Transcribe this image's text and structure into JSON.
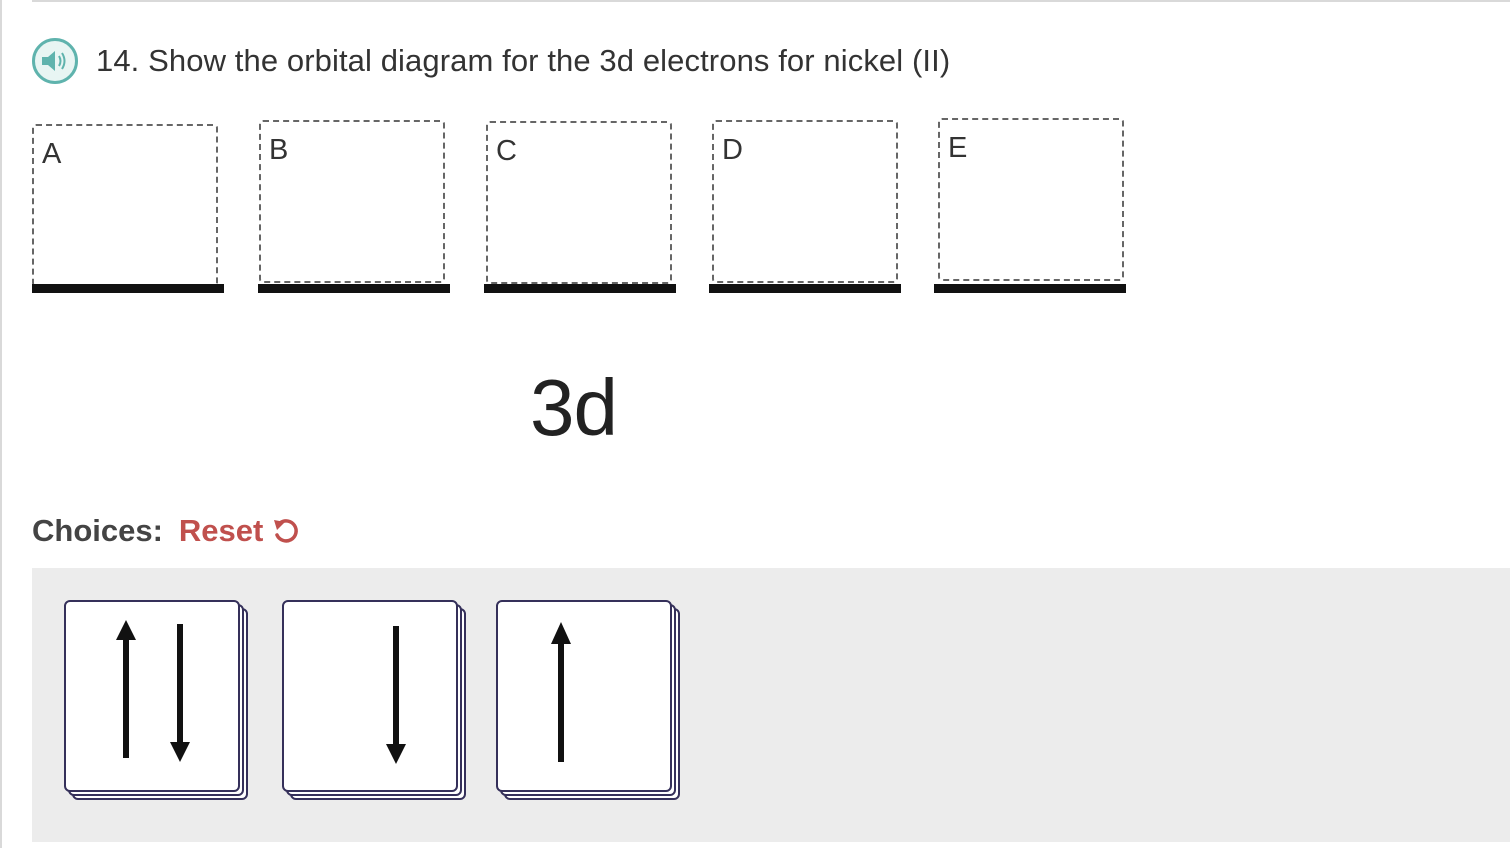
{
  "question": {
    "text": "14.  Show the orbital diagram for the 3d electrons for nickel (II)",
    "audio_icon": "speaker-icon"
  },
  "orbitals": {
    "subshell_label": "3d",
    "drop_zones": [
      {
        "label": "A"
      },
      {
        "label": "B"
      },
      {
        "label": "C"
      },
      {
        "label": "D"
      },
      {
        "label": "E"
      }
    ]
  },
  "choices": {
    "label": "Choices:",
    "reset_label": "Reset",
    "reset_icon": "undo-icon",
    "cards": [
      {
        "name": "paired-up-down",
        "icon": "up-down-arrows-icon"
      },
      {
        "name": "single-down",
        "icon": "down-arrow-icon"
      },
      {
        "name": "single-up",
        "icon": "up-arrow-icon"
      }
    ]
  },
  "colors": {
    "accent_teal": "#5fb3ad",
    "reset_red": "#c0504d",
    "card_border": "#35305a",
    "tray_bg": "#ececec"
  }
}
